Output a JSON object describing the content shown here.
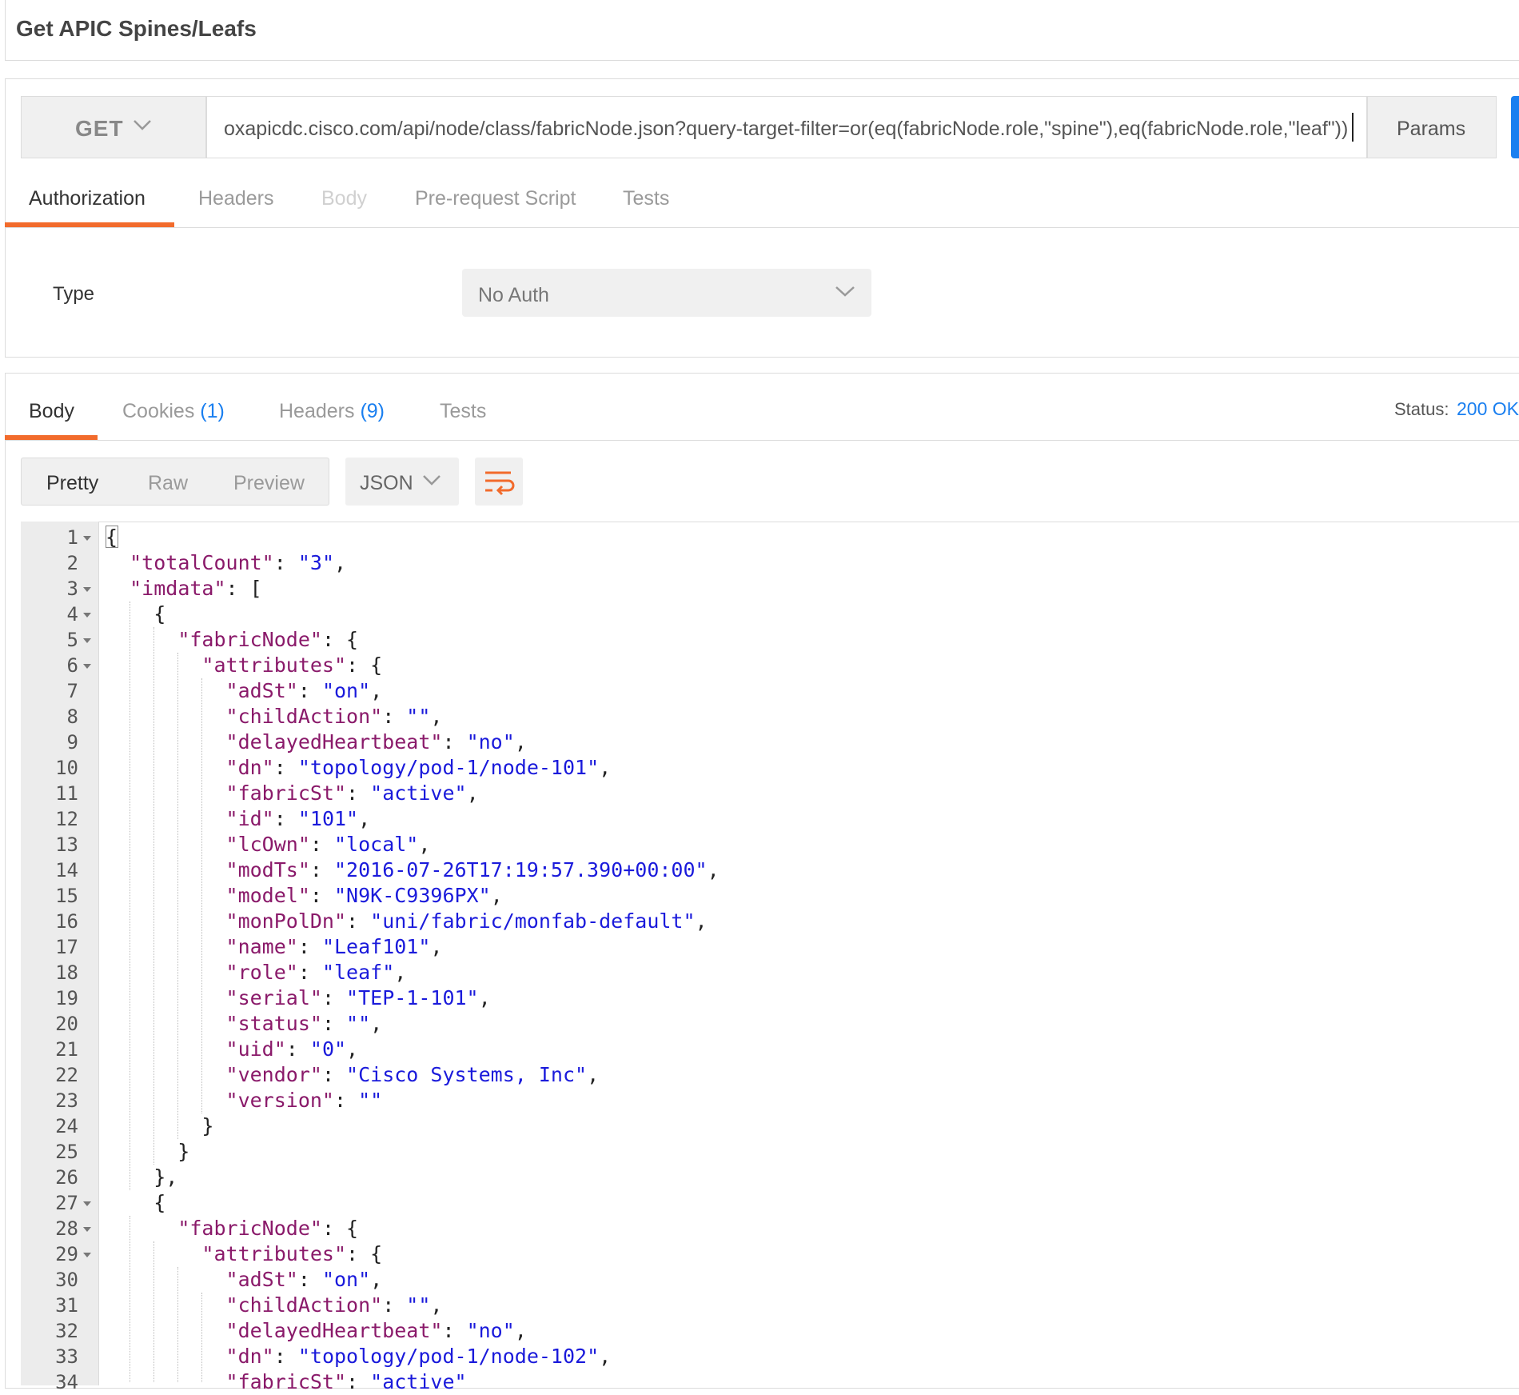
{
  "title": "Get APIC Spines/Leafs",
  "request": {
    "method": "GET",
    "url": "oxapicdc.cisco.com/api/node/class/fabricNode.json?query-target-filter=or(eq(fabricNode.role,\"spine\"),eq(fabricNode.role,\"leaf\"))",
    "params_label": "Params",
    "tabs": [
      "Authorization",
      "Headers",
      "Body",
      "Pre-request Script",
      "Tests"
    ],
    "active_tab": "Authorization",
    "auth": {
      "type_label": "Type",
      "type_value": "No Auth"
    }
  },
  "response": {
    "tabs": {
      "body": "Body",
      "cookies": "Cookies",
      "cookies_count": "(1)",
      "headers": "Headers",
      "headers_count": "(9)",
      "tests": "Tests"
    },
    "status_label": "Status:",
    "status_value": "200 OK",
    "view_modes": [
      "Pretty",
      "Raw",
      "Preview"
    ],
    "active_view": "Pretty",
    "format": "JSON",
    "line_numbers": [
      "1",
      "2",
      "3",
      "4",
      "5",
      "6",
      "7",
      "8",
      "9",
      "10",
      "11",
      "12",
      "13",
      "14",
      "15",
      "16",
      "17",
      "18",
      "19",
      "20",
      "21",
      "22",
      "23",
      "24",
      "25",
      "26",
      "27",
      "28",
      "29",
      "30",
      "31",
      "32",
      "33",
      "34"
    ],
    "code_lines": [
      [
        {
          "t": "p",
          "v": "{"
        }
      ],
      [
        {
          "t": "p",
          "v": "  "
        },
        {
          "t": "k",
          "v": "\"totalCount\""
        },
        {
          "t": "p",
          "v": ": "
        },
        {
          "t": "s",
          "v": "\"3\""
        },
        {
          "t": "p",
          "v": ","
        }
      ],
      [
        {
          "t": "p",
          "v": "  "
        },
        {
          "t": "k",
          "v": "\"imdata\""
        },
        {
          "t": "p",
          "v": ": ["
        }
      ],
      [
        {
          "t": "p",
          "v": "    {"
        }
      ],
      [
        {
          "t": "p",
          "v": "      "
        },
        {
          "t": "k",
          "v": "\"fabricNode\""
        },
        {
          "t": "p",
          "v": ": {"
        }
      ],
      [
        {
          "t": "p",
          "v": "        "
        },
        {
          "t": "k",
          "v": "\"attributes\""
        },
        {
          "t": "p",
          "v": ": {"
        }
      ],
      [
        {
          "t": "p",
          "v": "          "
        },
        {
          "t": "k",
          "v": "\"adSt\""
        },
        {
          "t": "p",
          "v": ": "
        },
        {
          "t": "s",
          "v": "\"on\""
        },
        {
          "t": "p",
          "v": ","
        }
      ],
      [
        {
          "t": "p",
          "v": "          "
        },
        {
          "t": "k",
          "v": "\"childAction\""
        },
        {
          "t": "p",
          "v": ": "
        },
        {
          "t": "s",
          "v": "\"\""
        },
        {
          "t": "p",
          "v": ","
        }
      ],
      [
        {
          "t": "p",
          "v": "          "
        },
        {
          "t": "k",
          "v": "\"delayedHeartbeat\""
        },
        {
          "t": "p",
          "v": ": "
        },
        {
          "t": "s",
          "v": "\"no\""
        },
        {
          "t": "p",
          "v": ","
        }
      ],
      [
        {
          "t": "p",
          "v": "          "
        },
        {
          "t": "k",
          "v": "\"dn\""
        },
        {
          "t": "p",
          "v": ": "
        },
        {
          "t": "s",
          "v": "\"topology/pod-1/node-101\""
        },
        {
          "t": "p",
          "v": ","
        }
      ],
      [
        {
          "t": "p",
          "v": "          "
        },
        {
          "t": "k",
          "v": "\"fabricSt\""
        },
        {
          "t": "p",
          "v": ": "
        },
        {
          "t": "s",
          "v": "\"active\""
        },
        {
          "t": "p",
          "v": ","
        }
      ],
      [
        {
          "t": "p",
          "v": "          "
        },
        {
          "t": "k",
          "v": "\"id\""
        },
        {
          "t": "p",
          "v": ": "
        },
        {
          "t": "s",
          "v": "\"101\""
        },
        {
          "t": "p",
          "v": ","
        }
      ],
      [
        {
          "t": "p",
          "v": "          "
        },
        {
          "t": "k",
          "v": "\"lcOwn\""
        },
        {
          "t": "p",
          "v": ": "
        },
        {
          "t": "s",
          "v": "\"local\""
        },
        {
          "t": "p",
          "v": ","
        }
      ],
      [
        {
          "t": "p",
          "v": "          "
        },
        {
          "t": "k",
          "v": "\"modTs\""
        },
        {
          "t": "p",
          "v": ": "
        },
        {
          "t": "s",
          "v": "\"2016-07-26T17:19:57.390+00:00\""
        },
        {
          "t": "p",
          "v": ","
        }
      ],
      [
        {
          "t": "p",
          "v": "          "
        },
        {
          "t": "k",
          "v": "\"model\""
        },
        {
          "t": "p",
          "v": ": "
        },
        {
          "t": "s",
          "v": "\"N9K-C9396PX\""
        },
        {
          "t": "p",
          "v": ","
        }
      ],
      [
        {
          "t": "p",
          "v": "          "
        },
        {
          "t": "k",
          "v": "\"monPolDn\""
        },
        {
          "t": "p",
          "v": ": "
        },
        {
          "t": "s",
          "v": "\"uni/fabric/monfab-default\""
        },
        {
          "t": "p",
          "v": ","
        }
      ],
      [
        {
          "t": "p",
          "v": "          "
        },
        {
          "t": "k",
          "v": "\"name\""
        },
        {
          "t": "p",
          "v": ": "
        },
        {
          "t": "s",
          "v": "\"Leaf101\""
        },
        {
          "t": "p",
          "v": ","
        }
      ],
      [
        {
          "t": "p",
          "v": "          "
        },
        {
          "t": "k",
          "v": "\"role\""
        },
        {
          "t": "p",
          "v": ": "
        },
        {
          "t": "s",
          "v": "\"leaf\""
        },
        {
          "t": "p",
          "v": ","
        }
      ],
      [
        {
          "t": "p",
          "v": "          "
        },
        {
          "t": "k",
          "v": "\"serial\""
        },
        {
          "t": "p",
          "v": ": "
        },
        {
          "t": "s",
          "v": "\"TEP-1-101\""
        },
        {
          "t": "p",
          "v": ","
        }
      ],
      [
        {
          "t": "p",
          "v": "          "
        },
        {
          "t": "k",
          "v": "\"status\""
        },
        {
          "t": "p",
          "v": ": "
        },
        {
          "t": "s",
          "v": "\"\""
        },
        {
          "t": "p",
          "v": ","
        }
      ],
      [
        {
          "t": "p",
          "v": "          "
        },
        {
          "t": "k",
          "v": "\"uid\""
        },
        {
          "t": "p",
          "v": ": "
        },
        {
          "t": "s",
          "v": "\"0\""
        },
        {
          "t": "p",
          "v": ","
        }
      ],
      [
        {
          "t": "p",
          "v": "          "
        },
        {
          "t": "k",
          "v": "\"vendor\""
        },
        {
          "t": "p",
          "v": ": "
        },
        {
          "t": "s",
          "v": "\"Cisco Systems, Inc\""
        },
        {
          "t": "p",
          "v": ","
        }
      ],
      [
        {
          "t": "p",
          "v": "          "
        },
        {
          "t": "k",
          "v": "\"version\""
        },
        {
          "t": "p",
          "v": ": "
        },
        {
          "t": "s",
          "v": "\"\""
        }
      ],
      [
        {
          "t": "p",
          "v": "        }"
        }
      ],
      [
        {
          "t": "p",
          "v": "      }"
        }
      ],
      [
        {
          "t": "p",
          "v": "    },"
        }
      ],
      [
        {
          "t": "p",
          "v": "    {"
        }
      ],
      [
        {
          "t": "p",
          "v": "      "
        },
        {
          "t": "k",
          "v": "\"fabricNode\""
        },
        {
          "t": "p",
          "v": ": {"
        }
      ],
      [
        {
          "t": "p",
          "v": "        "
        },
        {
          "t": "k",
          "v": "\"attributes\""
        },
        {
          "t": "p",
          "v": ": {"
        }
      ],
      [
        {
          "t": "p",
          "v": "          "
        },
        {
          "t": "k",
          "v": "\"adSt\""
        },
        {
          "t": "p",
          "v": ": "
        },
        {
          "t": "s",
          "v": "\"on\""
        },
        {
          "t": "p",
          "v": ","
        }
      ],
      [
        {
          "t": "p",
          "v": "          "
        },
        {
          "t": "k",
          "v": "\"childAction\""
        },
        {
          "t": "p",
          "v": ": "
        },
        {
          "t": "s",
          "v": "\"\""
        },
        {
          "t": "p",
          "v": ","
        }
      ],
      [
        {
          "t": "p",
          "v": "          "
        },
        {
          "t": "k",
          "v": "\"delayedHeartbeat\""
        },
        {
          "t": "p",
          "v": ": "
        },
        {
          "t": "s",
          "v": "\"no\""
        },
        {
          "t": "p",
          "v": ","
        }
      ],
      [
        {
          "t": "p",
          "v": "          "
        },
        {
          "t": "k",
          "v": "\"dn\""
        },
        {
          "t": "p",
          "v": ": "
        },
        {
          "t": "s",
          "v": "\"topology/pod-1/node-102\""
        },
        {
          "t": "p",
          "v": ","
        }
      ],
      [
        {
          "t": "p",
          "v": "          "
        },
        {
          "t": "k",
          "v": "\"fabricSt\""
        },
        {
          "t": "p",
          "v": ": "
        },
        {
          "t": "s",
          "v": "\"active\""
        }
      ]
    ],
    "foldable_lines": [
      "1",
      "3",
      "4",
      "5",
      "6",
      "27",
      "28",
      "29"
    ]
  },
  "icons": {
    "method_chevron": "chevron-down-icon",
    "auth_chevron": "chevron-down-icon",
    "format_chevron": "chevron-down-icon",
    "wrap": "wrap-lines-icon",
    "fold": "fold-arrow-icon"
  },
  "colors": {
    "accent": "#f26b2c",
    "link": "#1a7ff0",
    "json_key": "#8a1a6a",
    "json_string": "#1a1adb"
  }
}
